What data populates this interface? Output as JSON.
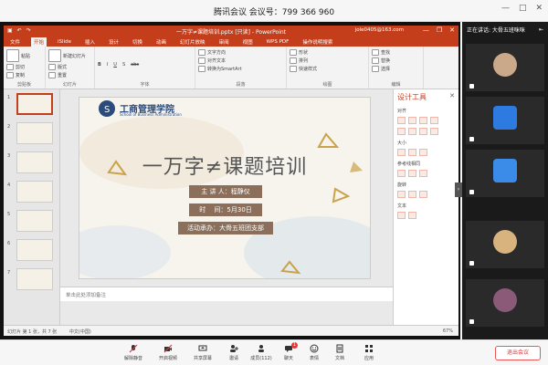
{
  "meeting": {
    "title": "腾讯会议 会议号：799 366 960",
    "window_controls": [
      "—",
      "□",
      "✕"
    ]
  },
  "ppt": {
    "doc_title": "一万字≠课题培训.pptx [只读] - PowerPoint",
    "account": "jole0405@163.com",
    "tabs": [
      "文件",
      "开始",
      "iSlide",
      "插入",
      "设计",
      "切换",
      "动画",
      "幻灯片放映",
      "审阅",
      "视图",
      "WPS PDF",
      "操作说明搜索"
    ],
    "active_tab": "开始",
    "ribbon_groups": [
      {
        "label": "剪贴板",
        "items": [
          "粘贴",
          "剪切",
          "复制"
        ]
      },
      {
        "label": "幻灯片",
        "items": [
          "新建幻灯片",
          "版式",
          "重置",
          "节"
        ]
      },
      {
        "label": "字体",
        "items": [
          "B",
          "I",
          "U",
          "S",
          "abc"
        ]
      },
      {
        "label": "段落",
        "items": [
          "文字方向",
          "对齐文本",
          "转换为SmartArt"
        ]
      },
      {
        "label": "绘图",
        "items": [
          "形状",
          "排列",
          "快速样式"
        ]
      },
      {
        "label": "编辑",
        "items": [
          "查找",
          "替换",
          "选择"
        ]
      }
    ],
    "slide": {
      "logo_title": "工商管理学院",
      "logo_sub": "School of Business Administration",
      "main_title": "一万字≠课题培训",
      "lines": [
        {
          "label": "主 讲 人：",
          "value": "程静仪"
        },
        {
          "label": "时　 间：",
          "value": "5月30日"
        },
        {
          "label": "活动承办：",
          "value": "大骨五班团支部"
        }
      ]
    },
    "thumbnail_numbers": [
      "1",
      "2",
      "3",
      "4",
      "5",
      "6",
      "7"
    ],
    "notes_placeholder": "单击此处添加备注",
    "status": {
      "left": "幻灯片 第 1 张，共 7 张",
      "lang": "中文(中国)",
      "zoom": "67%"
    },
    "design_pane": {
      "title": "设计工具",
      "sections": [
        "对齐",
        "大小",
        "参考线相同",
        "旋转",
        "文本"
      ]
    }
  },
  "side_panel": {
    "header": "正在讲话: 大骨五班咪咪",
    "tiles": [
      {
        "color": "#c9a98a"
      },
      {
        "color": "#2d7be0"
      },
      {
        "color": "#3b8be8"
      },
      {
        "color": "#d9b37d"
      },
      {
        "color": "#8a5a78"
      }
    ]
  },
  "toolbar": {
    "items": [
      "解除静音",
      "开启视频",
      "共享屏幕",
      "邀请",
      "成员(112)",
      "聊天",
      "表情",
      "文档",
      "应用"
    ],
    "end_label": "退出会议",
    "chat_badge": "1"
  },
  "colors": {
    "ppt_accent": "#c43e1c",
    "slide_bg": "#f7f4ee",
    "slide_title": "#555555",
    "line_box": "#8b6f5a",
    "end_red": "#e33333"
  }
}
